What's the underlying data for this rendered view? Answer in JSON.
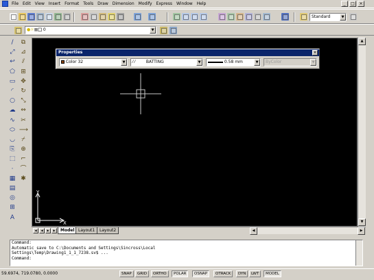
{
  "menubar": {
    "items": [
      "File",
      "Edit",
      "View",
      "Insert",
      "Format",
      "Tools",
      "Draw",
      "Dimension",
      "Modify",
      "Express",
      "Window",
      "Help"
    ],
    "window_controls": [
      "_",
      "□",
      "×"
    ]
  },
  "toolbar": {
    "text_style": "Standard"
  },
  "layers": {
    "current": "0"
  },
  "properties": {
    "title": "Properties",
    "color": "Color 32",
    "linetype": "BATTING",
    "lineweight": "0.58 mm",
    "plot_style": "ByColor",
    "color_swatch": "#8b4513"
  },
  "tabs": {
    "model": "Model",
    "layout1": "Layout1",
    "layout2": "Layout2"
  },
  "ucs": {
    "x_label": "X",
    "y_label": "Y"
  },
  "command": {
    "lines": [
      "Command:",
      "Automatic save to C:\\Documents and Settings\\Sincross\\Local",
      "Settings\\Temp\\Drawing1_1_1_7238.sv$ ...",
      "Command:"
    ]
  },
  "status": {
    "coords": "59.6974, 719.0780, 0.0000",
    "buttons": [
      "SNAP",
      "GRID",
      "ORTHO",
      "POLAR",
      "OSNAP",
      "OTRACK",
      "DYN",
      "LWT",
      "MODEL"
    ],
    "active": [
      "POLAR",
      "OSNAP",
      "MODEL"
    ]
  },
  "colors": {
    "titlebar": "#0a246a",
    "canvas": "#000000",
    "chrome": "#d4d0c8"
  }
}
